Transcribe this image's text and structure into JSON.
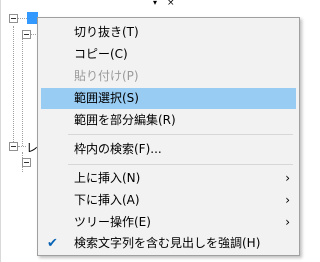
{
  "panel": {
    "tree_label": "レ"
  },
  "menu": {
    "items": [
      {
        "label": "切り抜き(T)",
        "disabled": false
      },
      {
        "label": "コピー(C)",
        "disabled": false
      },
      {
        "label": "貼り付け(P)",
        "disabled": true
      },
      {
        "label": "範囲選択(S)",
        "disabled": false,
        "highlighted": true
      },
      {
        "label": "範囲を部分編集(R)",
        "disabled": false
      },
      {
        "label": "枠内の検索(F)...",
        "disabled": false
      },
      {
        "label": "上に挿入(N)",
        "submenu": true
      },
      {
        "label": "下に挿入(A)",
        "submenu": true
      },
      {
        "label": "ツリー操作(E)",
        "submenu": true
      },
      {
        "label": "検索文字列を含む見出しを強調(H)",
        "checked": true
      }
    ],
    "submenu_arrow": "›",
    "check_mark": "✔"
  },
  "colors": {
    "highlight": "#99ccf3",
    "menu_bg": "#f2f2f2",
    "tree_selected": "#3399ff"
  },
  "icons": {
    "pin": "▾",
    "close": "×"
  }
}
